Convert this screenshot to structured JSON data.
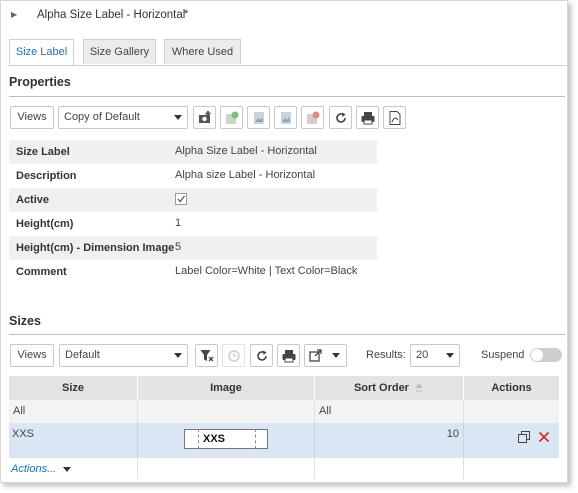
{
  "window": {
    "title": "Alpha Size Label - Horizontal",
    "dirty_marker": "*"
  },
  "tabs": [
    {
      "label": "Size Label",
      "active": true
    },
    {
      "label": "Size Gallery",
      "active": false
    },
    {
      "label": "Where Used",
      "active": false
    }
  ],
  "properties": {
    "heading": "Properties",
    "views_label": "Views",
    "view_select_value": "Copy of Default",
    "toolbar_icons": [
      "add-image-icon",
      "image-add-green-icon",
      "image-icon",
      "image-icon",
      "image-remove-red-icon",
      "refresh-icon",
      "print-icon",
      "pdf-icon"
    ],
    "fields": [
      {
        "label": "Size Label",
        "value": "Alpha Size Label - Horizontal"
      },
      {
        "label": "Description",
        "value": "Alpha size Label - Horizontal"
      },
      {
        "label": "Active",
        "value": "",
        "checked": true
      },
      {
        "label": "Height(cm)",
        "value": "1"
      },
      {
        "label": "Height(cm) - Dimension Image",
        "value": "5"
      },
      {
        "label": "Comment",
        "value": "Label Color=White | Text Color=Black"
      }
    ]
  },
  "sizes": {
    "heading": "Sizes",
    "views_label": "Views",
    "view_select_value": "Default",
    "results_label": "Results:",
    "results_value": "20",
    "suspend_label": "Suspend",
    "suspend_on": false,
    "columns": [
      "Size",
      "Image",
      "Sort Order",
      "Actions"
    ],
    "filters": [
      "All",
      "",
      "All",
      ""
    ],
    "rows": [
      {
        "size": "XXS",
        "image_text": "XXS",
        "sort_order": "10"
      }
    ],
    "actions_label": "Actions..."
  },
  "colors": {
    "accent": "#1d6fb8",
    "row_selected": "#dbe6f5",
    "delete": "#d9242b"
  }
}
